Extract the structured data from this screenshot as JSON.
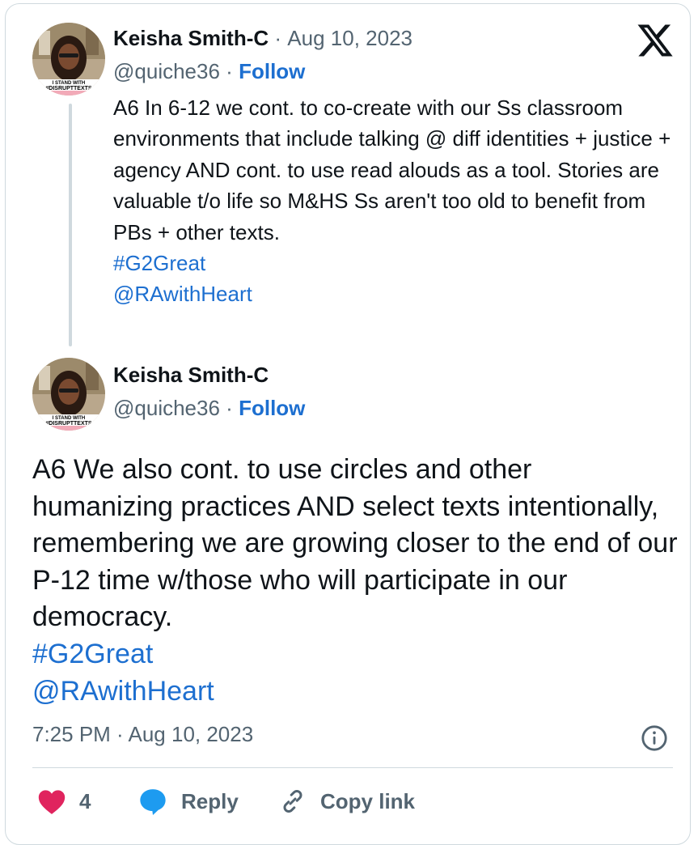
{
  "colors": {
    "accent": "#1d6fd0",
    "like": "#e0245e",
    "reply": "#1d9bf0",
    "muted": "#536471",
    "text": "#0f1419"
  },
  "tweet1": {
    "author": "Keisha Smith-C",
    "dot": "·",
    "date": "Aug 10, 2023",
    "handle": "@quiche36",
    "follow_sep": "·",
    "follow": "Follow",
    "text": "A6 In 6-12 we cont. to co-create with our Ss classroom environments that include talking @ diff identities + justice + agency AND cont. to use read alouds as a tool. Stories are valuable t/o life so M&HS Ss aren't too old to benefit from PBs + other texts.",
    "hashtag": "#G2Great",
    "mention": "@RAwithHeart"
  },
  "tweet2": {
    "author": "Keisha Smith-C",
    "handle": "@quiche36",
    "follow_sep": "·",
    "follow": "Follow",
    "text": "A6 We also cont. to use circles and other humanizing practices AND select texts intentionally, remembering we are growing closer to the end of our P-12 time w/those who will participate in our democracy.",
    "hashtag": "#G2Great",
    "mention": "@RAwithHeart",
    "timestamp": "7:25 PM · Aug 10, 2023"
  },
  "avatar_badge": "I STAND WITH #DISRUPTTEXTS",
  "icons": {
    "logo": "x-logo-icon",
    "info": "info-icon",
    "like": "heart-icon",
    "reply": "speech-bubble-icon",
    "copy": "link-icon"
  },
  "actions": {
    "likes": "4",
    "reply": "Reply",
    "copy": "Copy link"
  }
}
